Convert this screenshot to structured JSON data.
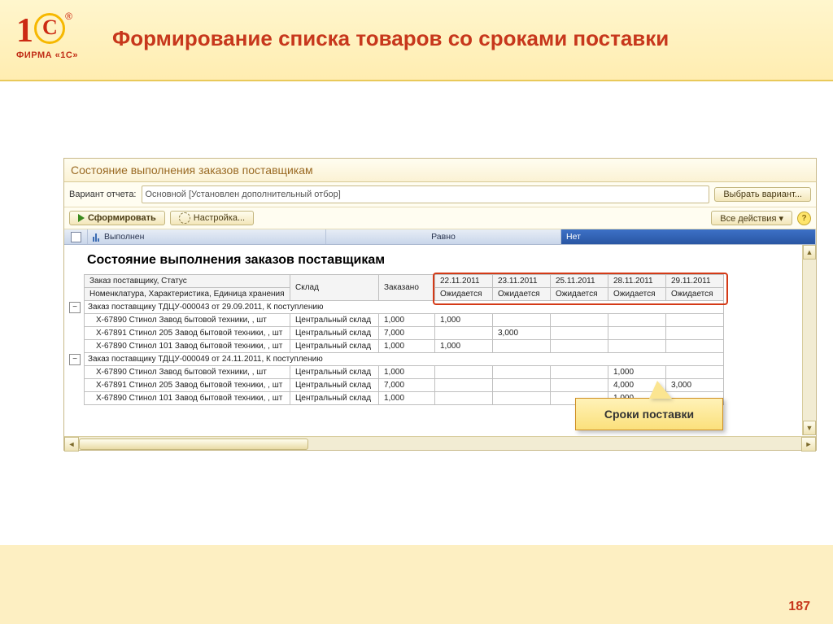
{
  "slide": {
    "logo_caption": "ФИРМА «1С»",
    "title": "Формирование списка товаров со сроками поставки",
    "page_number": "187"
  },
  "app": {
    "window_title": "Состояние выполнения заказов поставщикам",
    "variant_label": "Вариант отчета:",
    "variant_value": "Основной [Установлен дополнительный отбор]",
    "select_variant_btn": "Выбрать вариант...",
    "form_btn": "Сформировать",
    "settings_btn": "Настройка...",
    "all_actions_btn": "Все действия ▾",
    "help_btn": "?",
    "filter_field": "Выполнен",
    "filter_cond": "Равно",
    "filter_value": "Нет"
  },
  "report": {
    "title": "Состояние выполнения заказов поставщикам",
    "header_labels": {
      "order_status": "Заказ поставщику, Статус",
      "nomenclature": "Номенклатура, Характеристика, Единица хранения",
      "warehouse": "Склад",
      "ordered": "Заказано"
    },
    "date_columns": [
      "22.11.2011",
      "23.11.2011",
      "25.11.2011",
      "28.11.2011",
      "29.11.2011"
    ],
    "expected_label": "Ожидается",
    "groups": [
      {
        "title": "Заказ поставщику ТДЦУ-000043 от 29.09.2011, К поступлению",
        "rows": [
          {
            "nom": "Х-67890 Стинол Завод бытовой техники, , шт",
            "wh": "Центральный склад",
            "ord": "1,000",
            "cols": [
              "1,000",
              "",
              "",
              "",
              ""
            ]
          },
          {
            "nom": "Х-67891 Стинол 205 Завод бытовой техники, , шт",
            "wh": "Центральный склад",
            "ord": "7,000",
            "cols": [
              "",
              "3,000",
              "",
              "",
              ""
            ]
          },
          {
            "nom": "Х-67890 Стинол 101 Завод бытовой техники, , шт",
            "wh": "Центральный склад",
            "ord": "1,000",
            "cols": [
              "1,000",
              "",
              "",
              "",
              ""
            ]
          }
        ]
      },
      {
        "title": "Заказ поставщику ТДЦУ-000049 от 24.11.2011, К поступлению",
        "rows": [
          {
            "nom": "Х-67890 Стинол Завод бытовой техники, , шт",
            "wh": "Центральный склад",
            "ord": "1,000",
            "cols": [
              "",
              "",
              "",
              "1,000",
              ""
            ]
          },
          {
            "nom": "Х-67891 Стинол 205 Завод бытовой техники, , шт",
            "wh": "Центральный склад",
            "ord": "7,000",
            "cols": [
              "",
              "",
              "",
              "4,000",
              "3,000"
            ]
          },
          {
            "nom": "Х-67890 Стинол 101 Завод бытовой техники, , шт",
            "wh": "Центральный склад",
            "ord": "1,000",
            "cols": [
              "",
              "",
              "",
              "1,000",
              ""
            ]
          }
        ]
      }
    ]
  },
  "callout_text": "Сроки поставки"
}
